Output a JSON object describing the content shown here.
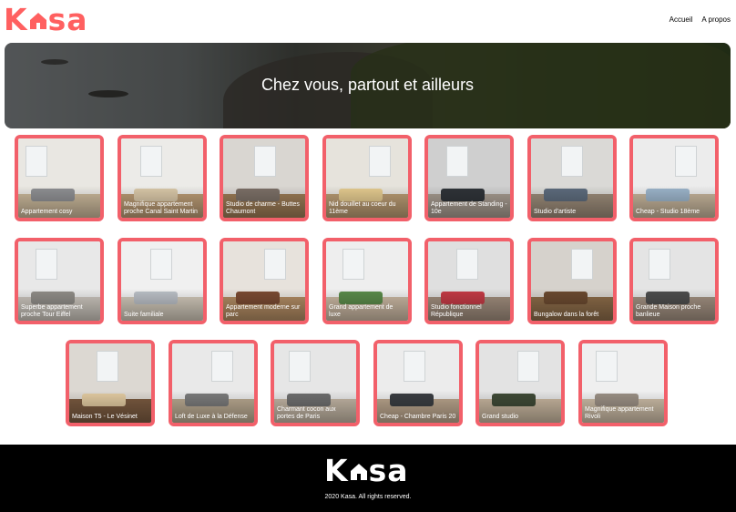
{
  "brand": {
    "left": "K",
    "right": "sa",
    "color": "#ff6060"
  },
  "nav": {
    "home": "Accueil",
    "about": "A propos"
  },
  "banner": {
    "title": "Chez vous, partout et ailleurs"
  },
  "listings": [
    {
      "title": "Appartement cosy"
    },
    {
      "title": "Magnifique appartement proche Canal Saint Martin"
    },
    {
      "title": "Studio de charme - Buttes Chaumont"
    },
    {
      "title": "Nid douillet au coeur du 11ème"
    },
    {
      "title": "Appartement de Standing - 10e"
    },
    {
      "title": "Studio d'artiste"
    },
    {
      "title": "Cheap - Studio 18ème"
    },
    {
      "title": "Superbe appartement proche Tour Eiffel"
    },
    {
      "title": "Suite familiale"
    },
    {
      "title": "Appartement moderne sur parc"
    },
    {
      "title": "Grand appartement de luxe"
    },
    {
      "title": "Studio fonctionnel République"
    },
    {
      "title": "Bungalow dans la forêt"
    },
    {
      "title": "Grande Maison proche banlieue"
    },
    {
      "title": "Maison T5 - Le Vésinet"
    },
    {
      "title": "Loft de Luxe à la Défense"
    },
    {
      "title": "Charmant cocon aux portes de Paris"
    },
    {
      "title": "Cheap - Chambre Paris 20"
    },
    {
      "title": "Grand studio"
    },
    {
      "title": "Magnifique appartement Rivoli"
    }
  ],
  "footer": {
    "copyright": "2020 Kasa. All rights reserved."
  }
}
